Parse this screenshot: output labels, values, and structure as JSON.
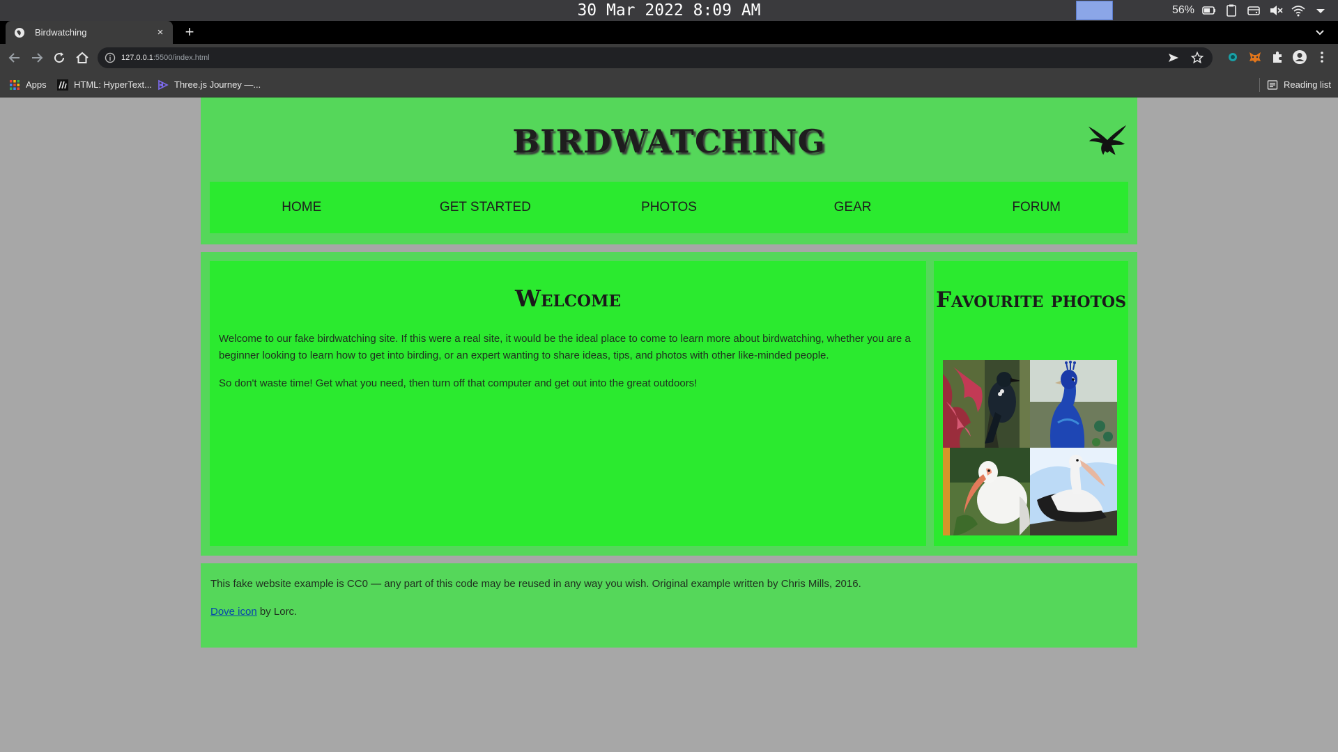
{
  "os": {
    "clock": "30 Mar 2022 8:09 AM",
    "battery_percent": "56%",
    "tray_icons": [
      "battery-icon",
      "clipboard-icon",
      "drive-icon",
      "volume-muted-icon",
      "wifi-icon",
      "tray-menu-icon"
    ]
  },
  "browser": {
    "tab": {
      "title": "Birdwatching",
      "close": "×"
    },
    "new_tab": "+",
    "url_host": "127.0.0.1",
    "url_rest": ":5500/index.html",
    "bookmarks": [
      {
        "label": "Apps",
        "icon": "apps-grid-icon"
      },
      {
        "label": "HTML: HyperText...",
        "icon": "mdn-icon"
      },
      {
        "label": "Three.js Journey —...",
        "icon": "threejs-journey-icon"
      }
    ],
    "reading_list": "Reading list"
  },
  "site": {
    "title": "BIRDWATCHING",
    "nav": [
      "HOME",
      "GET STARTED",
      "PHOTOS",
      "GEAR",
      "FORUM"
    ],
    "main": {
      "heading": "Welcome",
      "paragraph_1": "Welcome to our fake birdwatching site. If this were a real site, it would be the ideal place to come to learn more about birdwatching, whether you are a beginner looking to learn how to get into birding, or an expert wanting to share ideas, tips, and photos with other like-minded people.",
      "paragraph_2": "So don't waste time! Get what you need, then turn off that computer and get out into the great outdoors!"
    },
    "sidebar": {
      "heading": "Favourite photos",
      "photos": [
        "tui-photo",
        "peacock-photo",
        "ibis-photo",
        "pelican-photo"
      ]
    },
    "footer": {
      "line_1": "This fake website example is CC0 — any part of this code may be reused in any way you wish. Original example written by Chris Mills, 2016.",
      "link_text": "Dove icon",
      "line_2_rest": " by Lorc."
    }
  },
  "colors": {
    "header_bg": "#55d75a",
    "panel_bg": "#2bea2f",
    "page_bg": "#a7a7a7"
  }
}
